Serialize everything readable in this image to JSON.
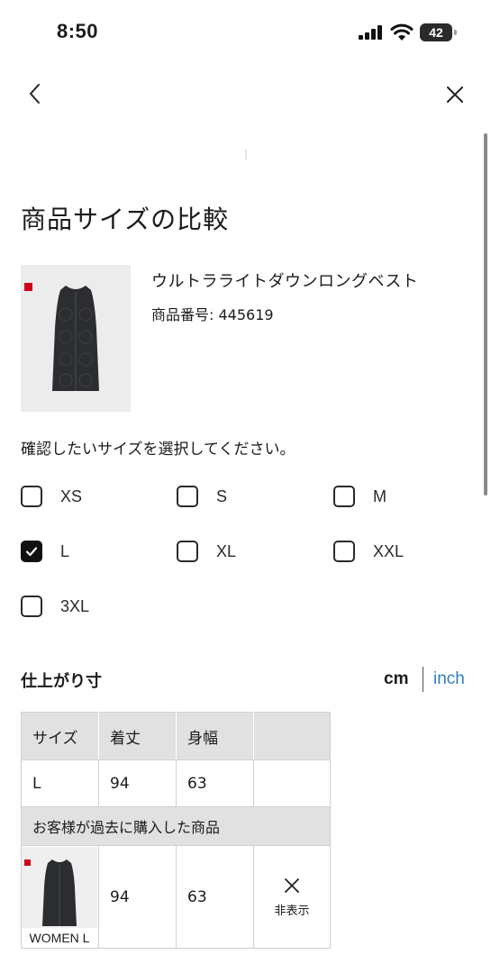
{
  "status_bar": {
    "time": "8:50",
    "battery": "42"
  },
  "page": {
    "title": "商品サイズの比較"
  },
  "product": {
    "name": "ウルトラライトダウンロングベスト",
    "number": "商品番号: 445619"
  },
  "size_select": {
    "prompt": "確認したいサイズを選択してください。",
    "options": [
      {
        "label": "XS",
        "checked": false
      },
      {
        "label": "S",
        "checked": false
      },
      {
        "label": "M",
        "checked": false
      },
      {
        "label": "L",
        "checked": true
      },
      {
        "label": "XL",
        "checked": false
      },
      {
        "label": "XXL",
        "checked": false
      },
      {
        "label": "3XL",
        "checked": false
      }
    ]
  },
  "measurements": {
    "title": "仕上がり寸",
    "unit_cm": "cm",
    "unit_inch": "inch",
    "headers": [
      "サイズ",
      "着丈",
      "身幅",
      ""
    ],
    "row": [
      "L",
      "94",
      "63"
    ],
    "purchased_label": "お客様が過去に購入した商品",
    "purchased": {
      "caption": "WOMEN L",
      "length": "94",
      "width": "63",
      "hide_label": "非表示"
    }
  },
  "colors": {
    "accent_link": "#2e7dc3",
    "checked_box": "#111111",
    "table_header": "#e1e1e1"
  }
}
